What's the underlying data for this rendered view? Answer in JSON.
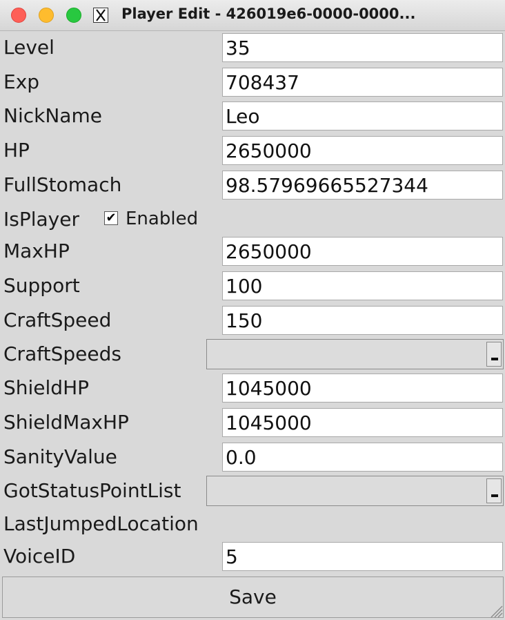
{
  "window": {
    "title": "Player Edit - 426019e6-0000-0000...",
    "buttons": {
      "close_color": "#fe5f57",
      "minimize_color": "#febc2e",
      "maximize_color": "#28c840"
    },
    "app_icon": "x11-icon"
  },
  "fields": {
    "level": {
      "label": "Level",
      "value": "35"
    },
    "exp": {
      "label": "Exp",
      "value": "708437"
    },
    "nickname": {
      "label": "NickName",
      "value": "Leo"
    },
    "hp": {
      "label": "HP",
      "value": "2650000"
    },
    "fullstomach": {
      "label": "FullStomach",
      "value": "98.57969665527344"
    },
    "isplayer": {
      "label": "IsPlayer",
      "checkbox_label": "Enabled",
      "checked": true
    },
    "maxhp": {
      "label": "MaxHP",
      "value": "2650000"
    },
    "support": {
      "label": "Support",
      "value": "100"
    },
    "craftspeed": {
      "label": "CraftSpeed",
      "value": "150"
    },
    "craftspeeds": {
      "label": "CraftSpeeds",
      "selected": ""
    },
    "shieldhp": {
      "label": "ShieldHP",
      "value": "1045000"
    },
    "shieldmaxhp": {
      "label": "ShieldMaxHP",
      "value": "1045000"
    },
    "sanityvalue": {
      "label": "SanityValue",
      "value": "0.0"
    },
    "gotstatuspointlist": {
      "label": "GotStatusPointList",
      "selected": ""
    },
    "lastjumpedlocation": {
      "label": "LastJumpedLocation"
    },
    "voiceid": {
      "label": "VoiceID",
      "value": "5"
    }
  },
  "actions": {
    "save_label": "Save"
  }
}
